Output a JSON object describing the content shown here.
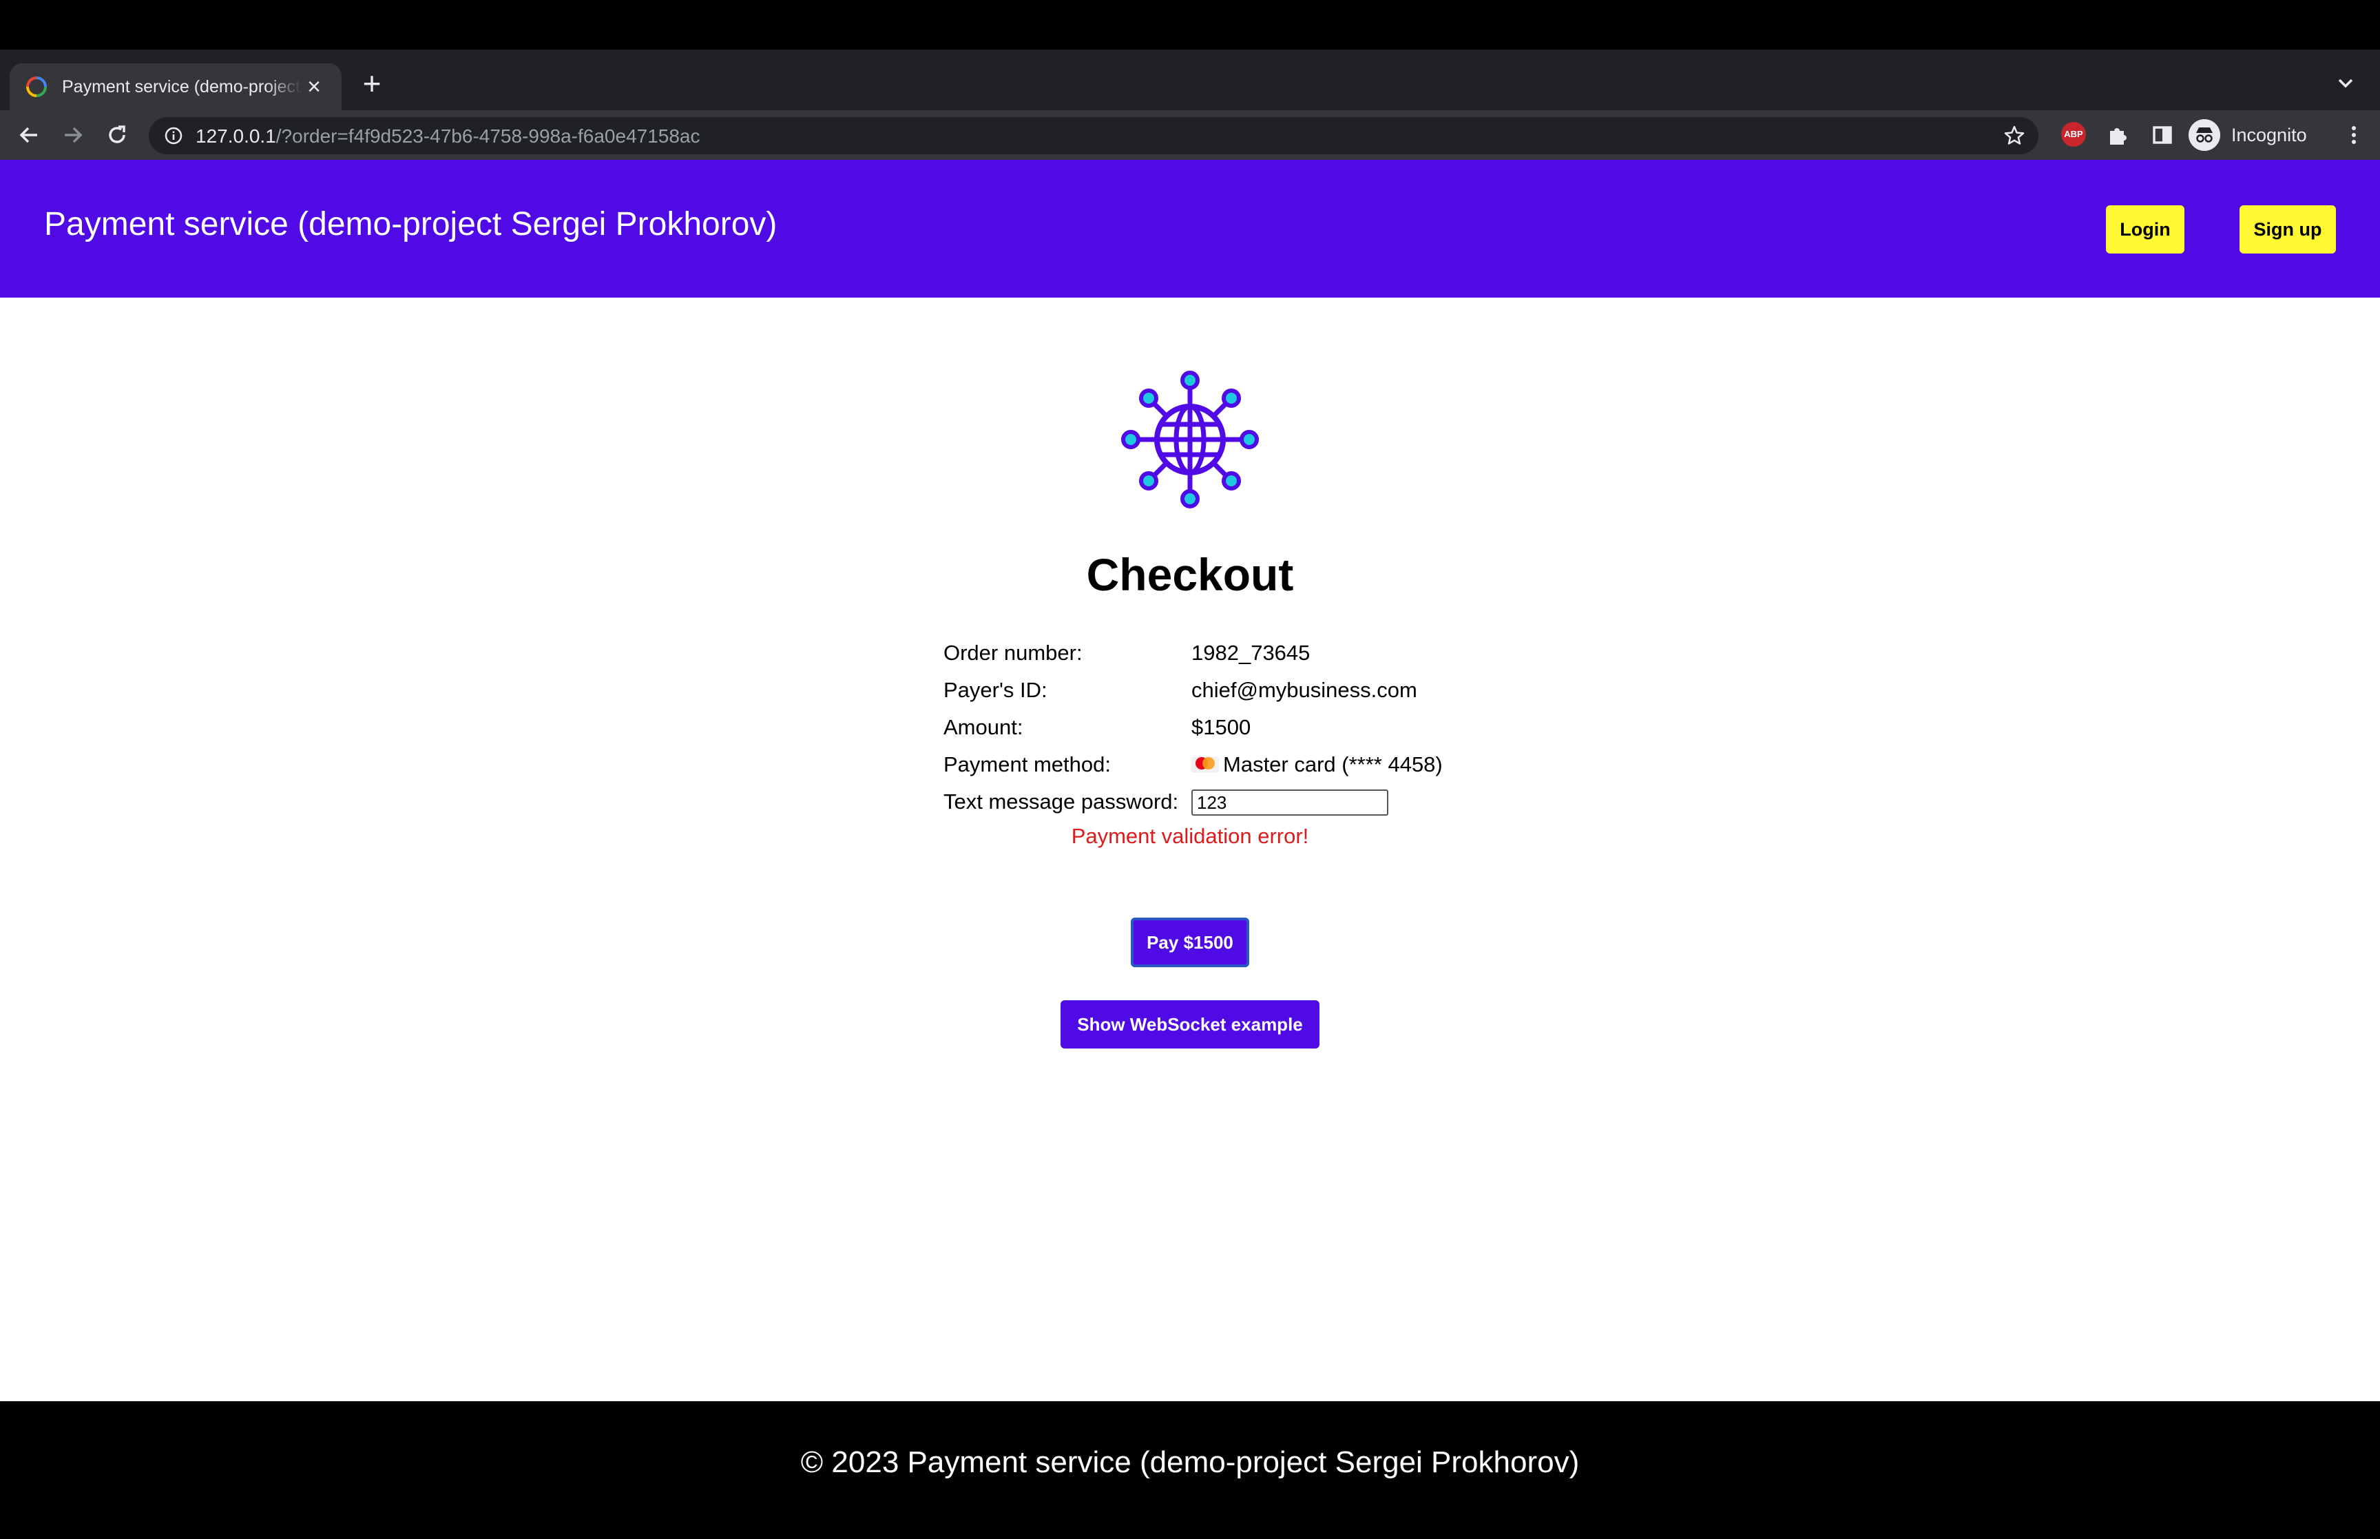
{
  "browser": {
    "tab": {
      "title": "Payment service (demo-project Sergei Prokhorov)"
    },
    "url": {
      "host": "127.0.0.1",
      "path": "/?order=f4f9d523-47b6-4758-998a-f6a0e47158ac"
    },
    "profile_label": "Incognito",
    "extension_abp_label": "ABP"
  },
  "header": {
    "brand": "Payment service (demo-project Sergei Prokhorov)",
    "login_label": "Login",
    "signup_label": "Sign up",
    "background_color": "#4f0ae6",
    "button_color": "#fff832"
  },
  "checkout": {
    "title": "Checkout",
    "order_label": "Order number:",
    "order_value": "1982_73645",
    "payer_label": "Payer's ID:",
    "payer_value": "chief@mybusiness.com",
    "amount_label": "Amount:",
    "amount_value": "$1500",
    "method_label": "Payment method:",
    "method_value": "Master card (**** 4458)",
    "password_label": "Text message password:",
    "password_value": "123",
    "error": "Payment validation error!",
    "pay_button": "Pay $1500",
    "websocket_button": "Show WebSocket example"
  },
  "footer": {
    "text": "© 2023 Payment service (demo-project Sergei Prokhorov)"
  }
}
